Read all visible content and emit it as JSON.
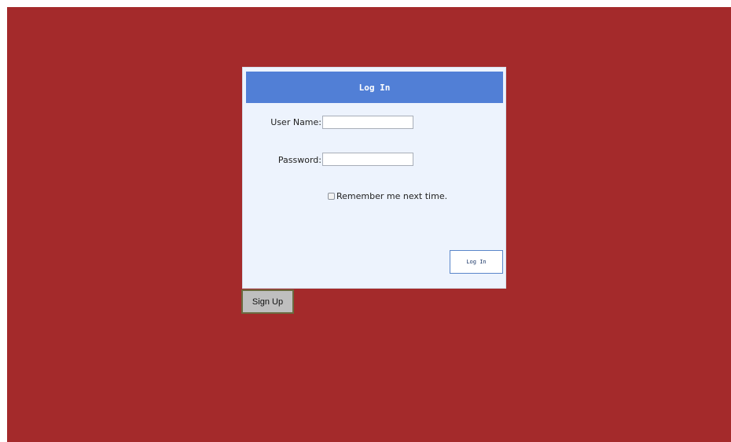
{
  "login": {
    "title": "Log In",
    "username_label": "User Name:",
    "username_value": "",
    "password_label": "Password:",
    "password_value": "",
    "remember_label": "Remember me next time.",
    "remember_checked": false,
    "submit_label": "Log In"
  },
  "signup": {
    "label": "Sign Up"
  },
  "colors": {
    "background": "#a42a2b",
    "panel": "#edf3fd",
    "header": "#517fd6",
    "button_border": "#5a86c9",
    "signup_bg": "#bfbfbf"
  }
}
